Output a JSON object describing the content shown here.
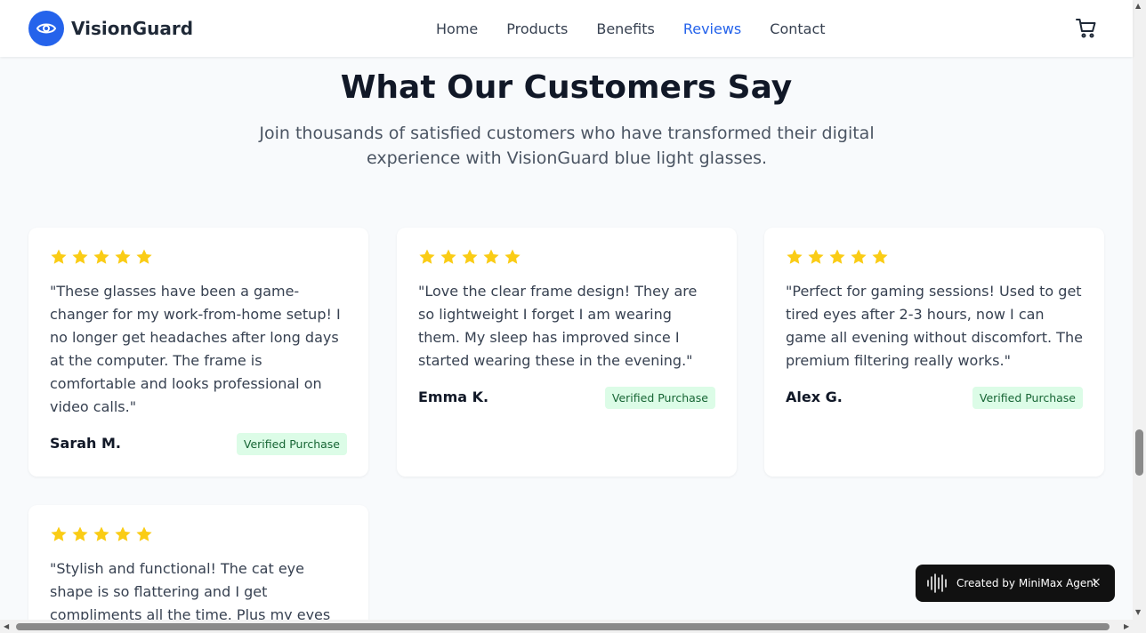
{
  "brand": {
    "name": "VisionGuard",
    "icon": "eye-icon",
    "color": "#2563eb"
  },
  "nav": {
    "items": [
      "Home",
      "Products",
      "Benefits",
      "Reviews",
      "Contact"
    ],
    "active": "Reviews",
    "cart_icon": "cart-icon"
  },
  "section": {
    "title": "What Our Customers Say",
    "subtitle": "Join thousands of satisfied customers who have transformed their digital experience with VisionGuard blue light glasses."
  },
  "reviews": [
    {
      "rating": 5,
      "quote": "\"These glasses have been a game-changer for my work-from-home setup! I no longer get headaches after long days at the computer. The frame is comfortable and looks professional on video calls.\"",
      "author": "Sarah M.",
      "badge": "Verified Purchase"
    },
    {
      "rating": 5,
      "quote": "\"Love the clear frame design! They are so lightweight I forget I am wearing them. My sleep has improved since I started wearing these in the evening.\"",
      "author": "Emma K.",
      "badge": "Verified Purchase"
    },
    {
      "rating": 5,
      "quote": "\"Perfect for gaming sessions! Used to get tired eyes after 2-3 hours, now I can game all evening without discomfort. The premium filtering really works.\"",
      "author": "Alex G.",
      "badge": "Verified Purchase"
    },
    {
      "rating": 5,
      "quote": "\"Stylish and functional! The cat eye shape is so flattering and I get compliments all the time. Plus my eyes",
      "author": "",
      "badge": ""
    }
  ],
  "colors": {
    "star": "#facc15",
    "badge_bg": "#dcfce7",
    "badge_text": "#166534"
  },
  "toast": {
    "text": "Created by MiniMax Agent",
    "close": "×",
    "icon": "waveform-icon"
  }
}
